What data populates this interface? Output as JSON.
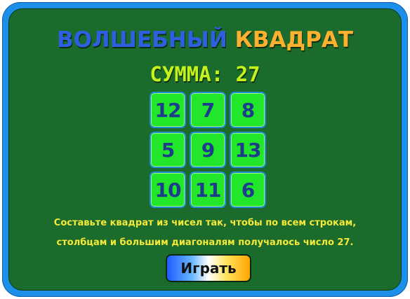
{
  "title": {
    "word1": "ВОЛШЕБНЫЙ",
    "word2": "КВАДРАТ"
  },
  "sum_label": "СУММА: 27",
  "grid": [
    [
      "12",
      "7",
      "8"
    ],
    [
      "5",
      "9",
      "13"
    ],
    [
      "10",
      "11",
      "6"
    ]
  ],
  "instructions": {
    "line1": "Составьте квадрат из чисел так, чтобы по всем строкам,",
    "line2": "столбцам и большим диагоналям получалось число 27."
  },
  "play_button": "Играть",
  "colors": {
    "board": "#1b6b2c",
    "frame": "#1c8fe8",
    "cell": "#22e62a",
    "cell_text": "#1d3c8c",
    "sum_text": "#c6f21c",
    "instructions_text": "#f5e93a",
    "title_blue": "#2d5fe0",
    "title_orange": "#ffb02e"
  }
}
